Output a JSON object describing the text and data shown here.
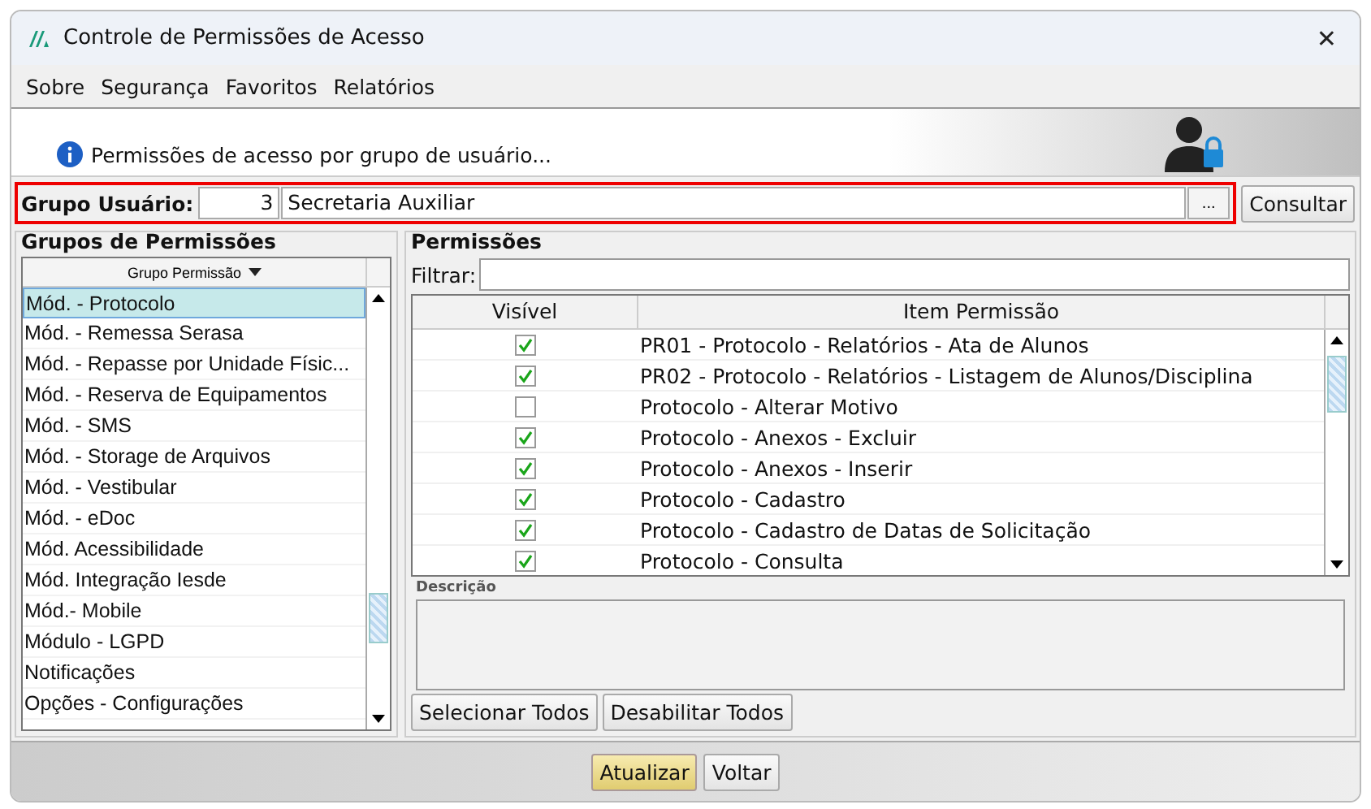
{
  "window": {
    "title": "Controle de Permissões de Acesso",
    "close": "✕"
  },
  "menu": [
    "Sobre",
    "Segurança",
    "Favoritos",
    "Relatórios"
  ],
  "banner": {
    "text": "Permissões de acesso por grupo de usuário..."
  },
  "user_group": {
    "label": "Grupo Usuário:",
    "code": "3",
    "name": "Secretaria Auxiliar",
    "browse": "...",
    "query_button": "Consultar"
  },
  "groups": {
    "title": "Grupos de Permissões",
    "column": "Grupo Permissão",
    "items": [
      {
        "label": "Mód. - Protocolo",
        "selected": true
      },
      {
        "label": "Mód. - Remessa Serasa",
        "selected": false
      },
      {
        "label": "Mód. - Repasse por Unidade Físic...",
        "selected": false
      },
      {
        "label": "Mód. - Reserva de Equipamentos",
        "selected": false
      },
      {
        "label": "Mód. - SMS",
        "selected": false
      },
      {
        "label": "Mód. - Storage de Arquivos",
        "selected": false
      },
      {
        "label": "Mód. - Vestibular",
        "selected": false
      },
      {
        "label": "Mód. - eDoc",
        "selected": false
      },
      {
        "label": "Mód. Acessibilidade",
        "selected": false
      },
      {
        "label": "Mód. Integração Iesde",
        "selected": false
      },
      {
        "label": "Mód.- Mobile",
        "selected": false
      },
      {
        "label": "Módulo - LGPD",
        "selected": false
      },
      {
        "label": "Notificações",
        "selected": false
      },
      {
        "label": "Opções - Configurações",
        "selected": false
      }
    ]
  },
  "permissions": {
    "title": "Permissões",
    "filter_label": "Filtrar:",
    "columns": [
      "Visível",
      "Item Permissão"
    ],
    "rows": [
      {
        "visible": true,
        "item": "PR01 - Protocolo - Relatórios - Ata de Alunos"
      },
      {
        "visible": true,
        "item": "PR02 - Protocolo - Relatórios - Listagem de Alunos/Disciplina"
      },
      {
        "visible": false,
        "item": "Protocolo - Alterar Motivo"
      },
      {
        "visible": true,
        "item": "Protocolo - Anexos - Excluir"
      },
      {
        "visible": true,
        "item": "Protocolo - Anexos - Inserir"
      },
      {
        "visible": true,
        "item": "Protocolo - Cadastro"
      },
      {
        "visible": true,
        "item": "Protocolo - Cadastro de Datas de Solicitação"
      },
      {
        "visible": true,
        "item": "Protocolo - Consulta"
      }
    ],
    "description_label": "Descrição",
    "buttons": [
      "Selecionar Todos",
      "Desabilitar Todos"
    ]
  },
  "footer_buttons": [
    {
      "label": "Atualizar",
      "kind": "primary"
    },
    {
      "label": "Voltar",
      "kind": "normal"
    }
  ]
}
